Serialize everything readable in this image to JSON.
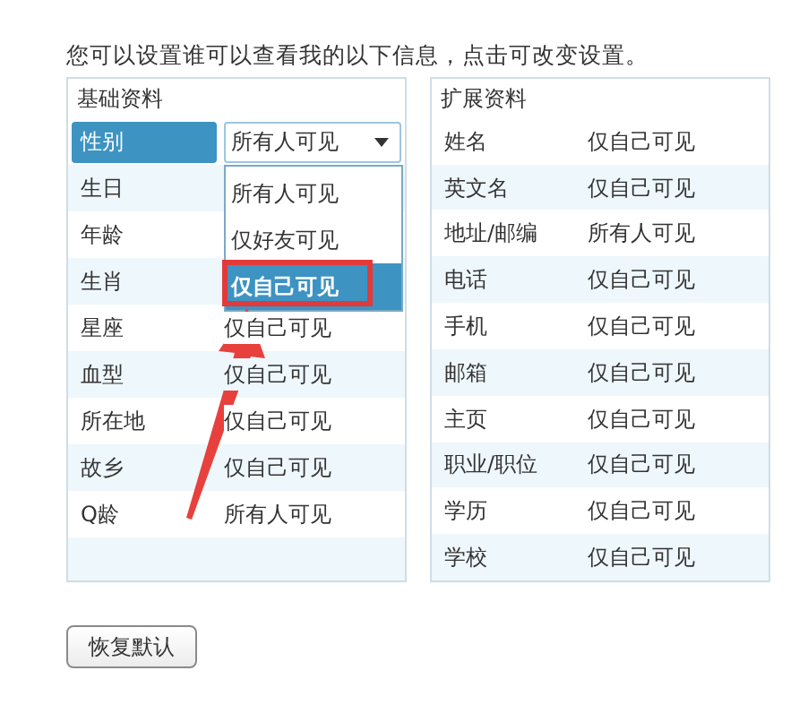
{
  "intro": "您可以设置谁可以查看我的以下信息，点击可改变设置。",
  "panels": [
    {
      "title": "基础资料",
      "rows": [
        {
          "label": "性别",
          "value": "所有人可见",
          "selected": true,
          "dropdown": {
            "expanded": true,
            "options": [
              {
                "label": "所有人可见",
                "selected": false
              },
              {
                "label": "仅好友可见",
                "selected": false
              },
              {
                "label": "仅自己可见",
                "selected": true
              }
            ]
          }
        },
        {
          "label": "生日",
          "selected": false
        },
        {
          "label": "年龄",
          "selected": false
        },
        {
          "label": "生肖",
          "selected": false
        },
        {
          "label": "星座",
          "value": "仅自己可见",
          "selected": false
        },
        {
          "label": "血型",
          "value": "仅自己可见",
          "selected": false
        },
        {
          "label": "所在地",
          "value": "仅自己可见",
          "selected": false
        },
        {
          "label": "故乡",
          "value": "仅自己可见",
          "selected": false
        },
        {
          "label": "Q龄",
          "value": "所有人可见",
          "selected": false
        }
      ]
    },
    {
      "title": "扩展资料",
      "rows": [
        {
          "label": "姓名",
          "value": "仅自己可见",
          "selected": false
        },
        {
          "label": "英文名",
          "value": "仅自己可见",
          "selected": false
        },
        {
          "label": "地址/邮编",
          "value": "所有人可见",
          "selected": false
        },
        {
          "label": "电话",
          "value": "仅自己可见",
          "selected": false
        },
        {
          "label": "手机",
          "value": "仅自己可见",
          "selected": false
        },
        {
          "label": "邮箱",
          "value": "仅自己可见",
          "selected": false
        },
        {
          "label": "主页",
          "value": "仅自己可见",
          "selected": false
        },
        {
          "label": "职业/职位",
          "value": "仅自己可见",
          "selected": false
        },
        {
          "label": "学历",
          "value": "仅自己可见",
          "selected": false
        },
        {
          "label": "学校",
          "value": "仅自己可见",
          "selected": false
        }
      ]
    }
  ],
  "button": "恢复默认"
}
